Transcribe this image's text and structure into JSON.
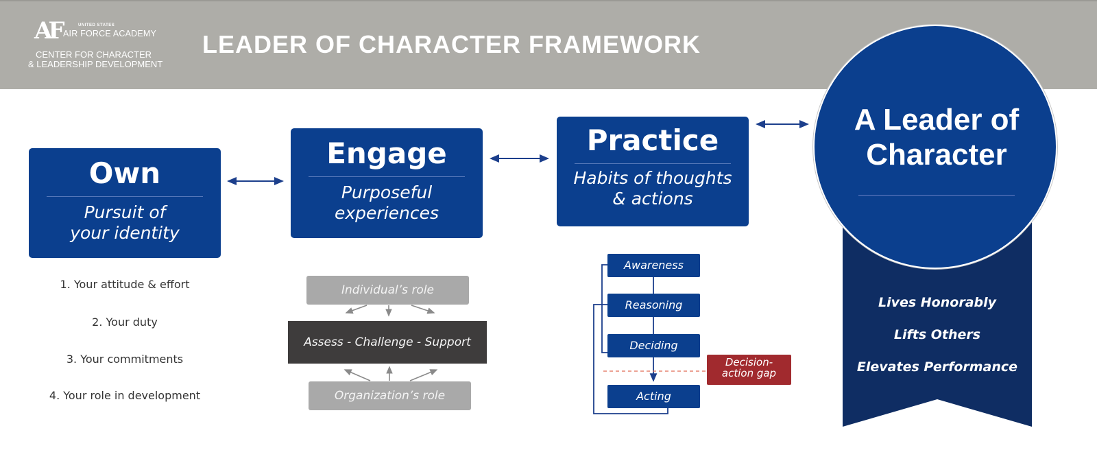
{
  "header": {
    "logo": {
      "mark": "AF",
      "line1": "UNITED STATES",
      "line2": "AIR FORCE ACADEMY",
      "line3": "CENTER FOR CHARACTER",
      "line4": "& LEADERSHIP DEVELOPMENT"
    },
    "title": "LEADER OF CHARACTER FRAMEWORK"
  },
  "colors": {
    "header_bg": "#aeada8",
    "primary_blue": "#0b3f8e",
    "ribbon_navy": "#0f2d63",
    "gray_box": "#a9a9a9",
    "dark_box": "#3e3c3c",
    "gap_red": "#a12a2e"
  },
  "own": {
    "heading": "Own",
    "subtitle_line1": "Pursuit of",
    "subtitle_line2": "your identity",
    "items": [
      "1. Your attitude & effort",
      "2. Your duty",
      "3. Your commitments",
      "4. Your role in development"
    ]
  },
  "engage": {
    "heading": "Engage",
    "subtitle_line1": "Purposeful",
    "subtitle_line2": "experiences",
    "individual_role": "Individual’s role",
    "core": "Assess - Challenge - Support",
    "organization_role": "Organization’s role"
  },
  "practice": {
    "heading": "Practice",
    "subtitle_line1": "Habits of thoughts",
    "subtitle_line2": "& actions",
    "steps": [
      "Awareness",
      "Reasoning",
      "Deciding",
      "Acting"
    ],
    "gap_line1": "Decision-",
    "gap_line2": "action gap"
  },
  "leader": {
    "title_line1": "A Leader of",
    "title_line2": "Character",
    "traits": [
      "Lives Honorably",
      "Lifts Others",
      "Elevates Performance"
    ]
  }
}
